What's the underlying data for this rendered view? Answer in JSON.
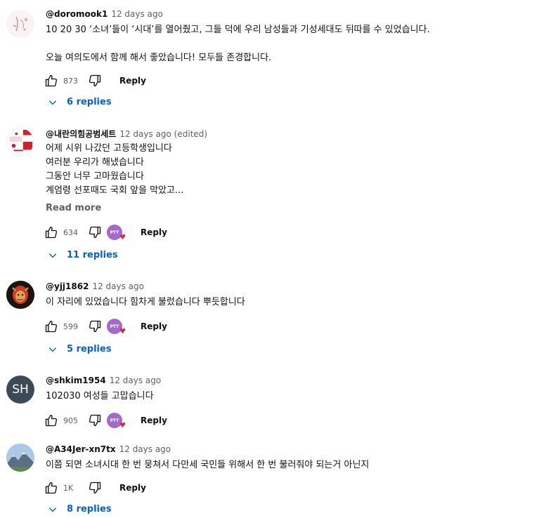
{
  "comments": [
    {
      "handle": "@doromook1",
      "time": "12 days ago",
      "lines": [
        "10 20 30 ‘소녀’들이 ‘시대’를 열어줬고, 그들 덕에 우리 남성들과 기성세대도 뒤따를 수 있었습니다.",
        "",
        "오늘 여의도에서 함께 해서 좋았습니다! 모두들 존경합니다."
      ],
      "likes": "873",
      "reply_label": "Reply",
      "replies": "6 replies",
      "avatar_icon": "sketch-avatar-icon"
    },
    {
      "handle": "@내란의힘공범세트",
      "time": "12 days ago (edited)",
      "lines": [
        "어제 시위 나갔던 고등학생입니다",
        "여러분 우리가 해냈습니다",
        "그동안 너무 고마웠습니다",
        "계엄령 선포때도 국회 앞을 막았고..."
      ],
      "read_more": "Read more",
      "likes": "634",
      "creator_badge": "PTT",
      "reply_label": "Reply",
      "replies": "11 replies",
      "avatar_icon": "party-logo-avatar-icon"
    },
    {
      "handle": "@yjj1862",
      "time": "12 days ago",
      "lines": [
        "이 자리에 있었습니다 힘차게 불렀습니다 뿌듯합니다"
      ],
      "likes": "599",
      "creator_badge": "PTT",
      "reply_label": "Reply",
      "replies": "5 replies",
      "avatar_icon": "warrior-avatar-icon"
    },
    {
      "handle": "@shkim1954",
      "time": "12 days ago",
      "lines": [
        "102030 여성들 고맙습니다"
      ],
      "likes": "905",
      "creator_badge": "PTT",
      "reply_label": "Reply",
      "avatar_initials": "SH",
      "avatar_color": "#3c4a57"
    },
    {
      "handle": "@A34Jer-xn7tx",
      "time": "12 days ago",
      "lines": [
        "이쯤 되면 소녀시대 한 번 뭉쳐서 다만세 국민들 위해서 한 번 불러줘야 되는거 아닌지"
      ],
      "likes": "1K",
      "reply_label": "Reply",
      "replies": "8 replies",
      "avatar_icon": "mountain-avatar-icon"
    }
  ],
  "colors": {
    "link_blue": "#065fd4",
    "muted": "#606060",
    "creator_purple": "#a36ac7",
    "heart_red": "#e0263d"
  }
}
